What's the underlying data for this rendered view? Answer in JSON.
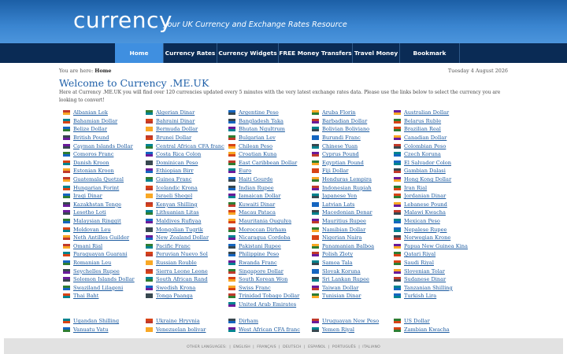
{
  "header": {
    "logo": "currency",
    "tagline": "your UK Currency and Exchange Rates Resource"
  },
  "nav": [
    {
      "label": "Home",
      "w": 62,
      "active": true
    },
    {
      "label": "Currency Rates",
      "w": 68
    },
    {
      "label": "Currency Widgets",
      "w": 78
    },
    {
      "label": "FREE Money Transfers",
      "w": 94
    },
    {
      "label": "Travel Money",
      "w": 60
    },
    {
      "label": "Bookmark",
      "w": 76
    }
  ],
  "breadcrumb": {
    "prefix": "You are here:",
    "current": "Home"
  },
  "date": "Tuesday 4 August 2026",
  "main": {
    "title": "Welcome to Currency .ME.UK",
    "intro": "Here at Currency .ME.UK you will find over 120 currencies updated every 5 minutes with the very latest exchange rates data. Please use the links below to select the currency you are looking to convert!"
  },
  "currencies": [
    [
      "Albanian Lek",
      "Algerian Dinar",
      "Argentine Peso",
      "Aruba Florin",
      "Australian Dollar"
    ],
    [
      "Bahamian Dollar",
      "Bahraini Dinar",
      "Bangladesh Taka",
      "Barbadian Dollar",
      "Belarus Ruble"
    ],
    [
      "Belize Dollar",
      "Bermuda Dollar",
      "Bhutan Ngultrum",
      "Bolivian Boliviano",
      "Brazilian Real"
    ],
    [
      "British Pound",
      "Brunei Dollar",
      "Bulgarian Lev",
      "Burundi Franc",
      "Canadian Dollar"
    ],
    [
      "Cayman Islands Dollar",
      "Central African CFA franc",
      "Chilean Peso",
      "Chinese Yuan",
      "Colombian Peso"
    ],
    [
      "Comoros Franc",
      "Costa Rica Colon",
      "Croatian Kuna",
      "Cyprus Pound",
      "Czech Koruna"
    ],
    [
      "Danish Kroon",
      "Dominican Peso",
      "East Caribbean Dollar",
      "Egyptian Pound",
      "El Salvador Colon"
    ],
    [
      "Estonian Kroon",
      "Ethiopian Birr",
      "Euro",
      "Fiji Dollar",
      "Gambian Dalasi"
    ],
    [
      "Guatemala Quetzal",
      "Guinea Franc",
      "Haiti Gourde",
      "Honduras Lempira",
      "Hong Kong Dollar"
    ],
    [
      "Hungarian Forint",
      "Icelandic Krona",
      "Indian Rupee",
      "Indonesian Rupiah",
      "Iran Rial"
    ],
    [
      "Iraqi Dinar",
      "Israeli Sheqel",
      "Jamaican Dollar",
      "Japanese Yen",
      "Jordanian Dinar"
    ],
    [
      "Kazakhstan Tenge",
      "Kenyan Shilling",
      "Kuwaiti Dinar",
      "Latvian Lats",
      "Lebanese Pound"
    ],
    [
      "Lesotho Loti",
      "Lithuanian Litas",
      "Macau Pataca",
      "Macedonian Denar",
      "Malawi Kwacha"
    ],
    [
      "Malaysian Ringgit",
      "Maldives Rufiyaa",
      "Mauritania Ougulya",
      "Mauritius Rupee",
      "Mexican Peso"
    ],
    [
      "Moldovan Leu",
      "Mongolian Tugrik",
      "Moroccan Dirham",
      "Namibian Dollar",
      "Nepalese Rupee"
    ],
    [
      "Neth Antilles Guilder",
      "New Zealand Dollar",
      "Nicaragua Cordoba",
      "Nigerian Naira",
      "Norwegian Krone"
    ],
    [
      "Omani Rial",
      "Pacific Franc",
      "Pakistani Rupee",
      "Panamanian Balboa",
      "Papua New Guinea Kina"
    ],
    [
      "Paraguayan Guarani",
      "Peruvian Nuevo Sol",
      "Philippine Peso",
      "Polish Zloty",
      "Qatari Riyal"
    ],
    [
      "Romanian Leu",
      "Russian Rouble",
      "Rwanda Franc",
      "Samoa Tala",
      "Saudi Riyal"
    ],
    [
      "Seychelles Rupee",
      "Sierra Leone Leone",
      "Singapore Dollar",
      "Slovak Koruna",
      "Slovenian Tolar"
    ],
    [
      "Solomon Islands Dollar",
      "South African Rand",
      "South Korean Won",
      "Sri Lankan Rupee",
      "Sudanese Dinar"
    ],
    [
      "Swaziland Lilageni",
      "Swedish Krona",
      "Swiss Franc",
      "Taiwan Dollar",
      "Tanzanian Shilling"
    ],
    [
      "Thai Baht",
      "Tonga Paanga",
      "Trinidad Tobago Dollar",
      "Tunisian Dinar",
      "Turkish Lira"
    ],
    [
      "",
      "",
      "United Arab Emirates",
      "",
      ""
    ],
    [
      "",
      "",
      "",
      "",
      ""
    ],
    [
      "Ugandan Shilling",
      "Ukraine Hryvnia",
      "Dirham",
      "Uruguayan New Peso",
      "US Dollar"
    ],
    [
      "Vanuatu Vatu",
      "Venezuelan bolivar",
      "West African CFA franc",
      "Yemen Riyal",
      "Zambian Kwacha"
    ]
  ],
  "flag_colors": [
    "#c0392b",
    "#2e7d32",
    "#1565c0",
    "#f9a825",
    "#6a1b9a",
    "#00838f",
    "#d84315",
    "#37474f"
  ],
  "footer": {
    "languages": [
      "OTHER LANGUAGES:",
      "ENGLISH",
      "FRANÇAIS",
      "DEUTSCH",
      "ESPAÑOL",
      "PORTUGUÊS",
      "ITALIANO"
    ]
  }
}
